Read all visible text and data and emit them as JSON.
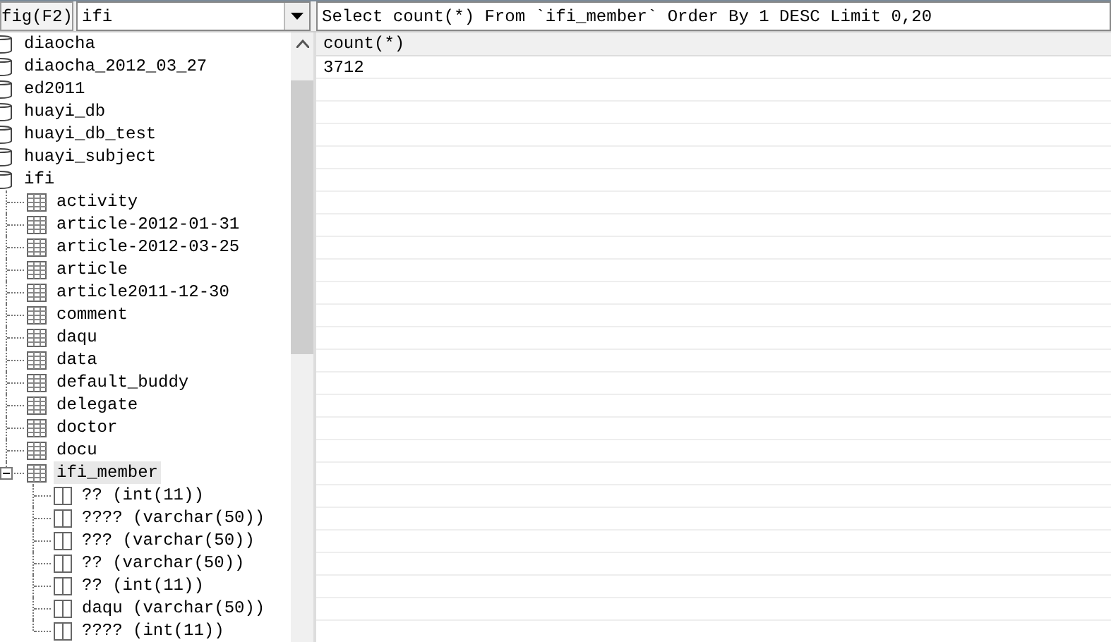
{
  "toolbar": {
    "config_button": "fig(F2)",
    "database_select": "ifi",
    "query": "Select count(*) From `ifi_member` Order By 1 DESC Limit 0,20"
  },
  "tree": [
    {
      "label": "diaocha",
      "selected": false
    },
    {
      "label": "diaocha_2012_03_27",
      "selected": false
    },
    {
      "label": "ed2011",
      "selected": false
    },
    {
      "label": "huayi_db",
      "selected": false
    },
    {
      "label": "huayi_db_test",
      "selected": false
    },
    {
      "label": "huayi_subject",
      "selected": false
    },
    {
      "label": "ifi",
      "selected": false,
      "children": [
        {
          "label": "activity",
          "selected": false,
          "expanded": false
        },
        {
          "label": "article-2012-01-31",
          "selected": false,
          "expanded": false
        },
        {
          "label": "article-2012-03-25",
          "selected": false,
          "expanded": false
        },
        {
          "label": "article",
          "selected": false,
          "expanded": false
        },
        {
          "label": "article2011-12-30",
          "selected": false,
          "expanded": false
        },
        {
          "label": "comment",
          "selected": false,
          "expanded": false
        },
        {
          "label": "daqu",
          "selected": false,
          "expanded": false
        },
        {
          "label": "data",
          "selected": false,
          "expanded": false
        },
        {
          "label": "default_buddy",
          "selected": false,
          "expanded": false
        },
        {
          "label": "delegate",
          "selected": false,
          "expanded": false
        },
        {
          "label": "doctor",
          "selected": false,
          "expanded": false
        },
        {
          "label": "docu",
          "selected": false,
          "expanded": false
        },
        {
          "label": "ifi_member",
          "selected": true,
          "expanded": true,
          "children": [
            {
              "label": "?? (int(11))",
              "selected": false
            },
            {
              "label": "???? (varchar(50))",
              "selected": false
            },
            {
              "label": "??? (varchar(50))",
              "selected": false
            },
            {
              "label": "?? (varchar(50))",
              "selected": false
            },
            {
              "label": "?? (int(11))",
              "selected": false
            },
            {
              "label": "daqu (varchar(50))",
              "selected": false
            },
            {
              "label": "???? (int(11))",
              "selected": false
            }
          ]
        }
      ]
    }
  ],
  "result": {
    "columns": [
      "count(*)"
    ],
    "rows": [
      [
        "3712"
      ]
    ]
  }
}
